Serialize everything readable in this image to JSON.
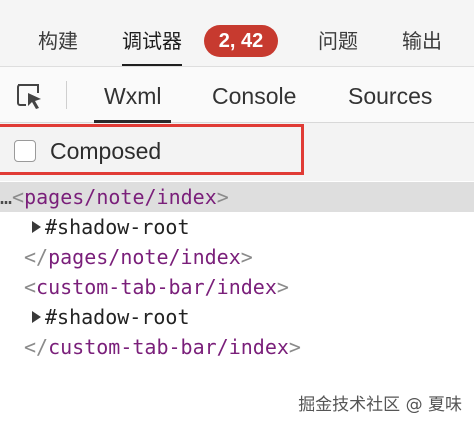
{
  "top_tabs": {
    "build": "构建",
    "debugger": "调试器",
    "counts": "2, 42",
    "issues": "问题",
    "output": "输出"
  },
  "sub_tabs": {
    "wxml": "Wxml",
    "console": "Console",
    "sources": "Sources"
  },
  "filter": {
    "composed_label": "Composed",
    "composed_checked": false
  },
  "tree": {
    "ellipsis": "…",
    "rows": [
      {
        "open": "<",
        "tag": "pages/note/index",
        "close": ">"
      },
      {
        "text": "#shadow-root"
      },
      {
        "open": "</",
        "tag": "pages/note/index",
        "close": ">"
      },
      {
        "open": "<",
        "tag": "custom-tab-bar/index",
        "close": ">"
      },
      {
        "text": "#shadow-root"
      },
      {
        "open": "</",
        "tag": "custom-tab-bar/index",
        "close": ">"
      }
    ]
  },
  "watermark": "掘金技术社区 @ 夏味",
  "colors": {
    "badge": "#c73a2f",
    "highlight_border": "#e03b35",
    "tag": "#7a1f7a"
  }
}
